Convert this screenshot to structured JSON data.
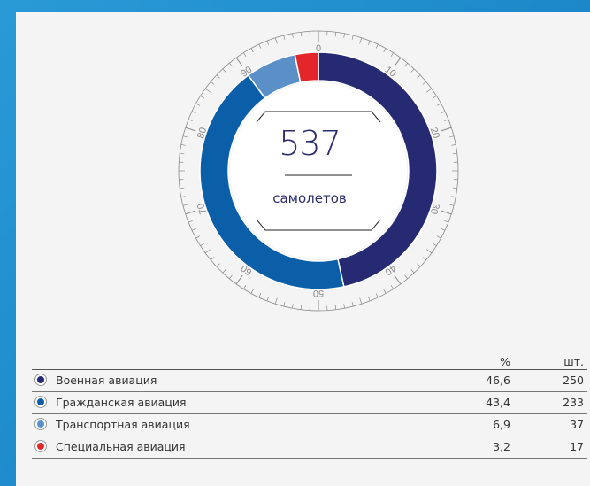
{
  "chart_data": {
    "type": "donut",
    "center_value": "537",
    "center_label": "самолетов",
    "scale_ticks": [
      "0",
      "10",
      "20",
      "30",
      "40",
      "50",
      "60",
      "70",
      "80",
      "90"
    ],
    "columns": {
      "percent": "%",
      "count": "шт."
    },
    "rows": [
      {
        "name": "Военная авиация",
        "percent": "46,6",
        "count": "250",
        "value": 46.6,
        "color": "#262a72"
      },
      {
        "name": "Гражданская авиация",
        "percent": "43,4",
        "count": "233",
        "value": 43.4,
        "color": "#0b5ea8"
      },
      {
        "name": "Транспортная авиация",
        "percent": "6,9",
        "count": "37",
        "value": 6.9,
        "color": "#5a8fc8"
      },
      {
        "name": "Специальная авиация",
        "percent": "3,2",
        "count": "17",
        "value": 3.2,
        "color": "#e3262a"
      }
    ]
  }
}
